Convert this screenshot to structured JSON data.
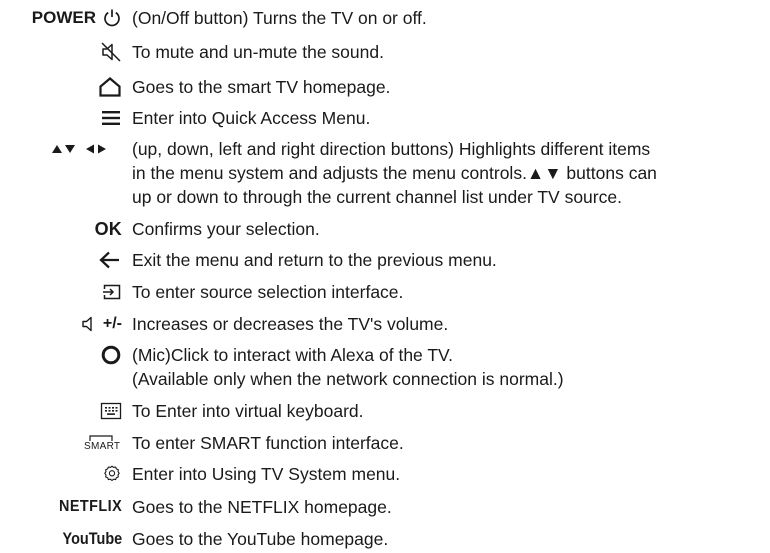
{
  "rows": [
    {
      "key_text": "POWER",
      "icon": "power-icon",
      "desc": [
        "(On/Off button) Turns the TV on or off."
      ]
    },
    {
      "icon": "mute-icon",
      "desc": [
        "To mute and un-mute the sound."
      ]
    },
    {
      "icon": "home-icon",
      "desc": [
        "Goes to the smart TV homepage."
      ]
    },
    {
      "icon": "menu-icon",
      "desc": [
        "Enter into Quick Access Menu."
      ]
    },
    {
      "key_text": "▲▼◀▶",
      "icon": "direction-arrows-icon",
      "desc": [
        "(up, down, left and right direction buttons) Highlights different items",
        "in the menu system and adjusts the menu controls.▲▼ buttons can",
        "up or down to through the current channel list under TV source."
      ]
    },
    {
      "key_text": "OK",
      "desc": [
        "Confirms your selection."
      ]
    },
    {
      "icon": "back-arrow-icon",
      "desc": [
        "Exit the menu and return to the previous menu."
      ]
    },
    {
      "icon": "source-input-icon",
      "desc": [
        "To enter source selection interface."
      ]
    },
    {
      "key_text": "+/-",
      "icon": "volume-icon",
      "desc": [
        "Increases or decreases the TV's volume."
      ]
    },
    {
      "icon": "mic-icon",
      "desc": [
        "(Mic)Click to interact with Alexa of the TV.",
        "(Available only when the network connection is normal.)"
      ]
    },
    {
      "icon": "keyboard-icon",
      "desc": [
        "To Enter into virtual keyboard."
      ]
    },
    {
      "key_text": "SMART",
      "icon": "smart-icon",
      "desc": [
        "To enter SMART function interface."
      ]
    },
    {
      "icon": "settings-gear-icon",
      "desc": [
        "Enter into Using TV System menu."
      ]
    },
    {
      "key_text": "NETFLIX",
      "desc": [
        "Goes to the NETFLIX homepage."
      ]
    },
    {
      "key_text": "YouTube",
      "desc": [
        "Goes to the YouTube homepage."
      ]
    }
  ],
  "colors": {
    "text": "#1a1a1a",
    "background": "#ffffff"
  }
}
